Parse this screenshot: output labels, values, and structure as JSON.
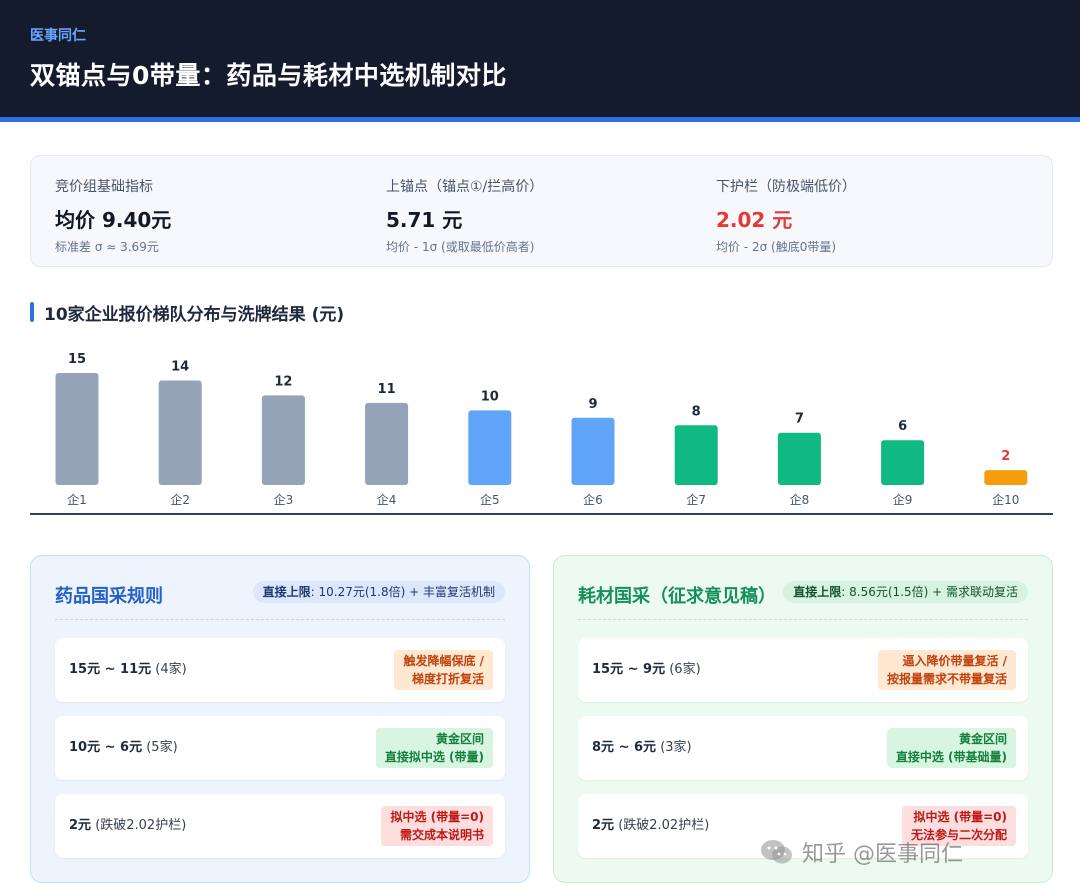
{
  "header": {
    "brand": "医事同仁",
    "title": "双锚点与0带量：药品与耗材中选机制对比"
  },
  "metrics": [
    {
      "label": "竞价组基础指标",
      "value": "均价 9.40元",
      "note": "标准差 σ ≈ 3.69元",
      "color": "#111827"
    },
    {
      "label": "上锚点（锚点①/拦高价）",
      "value": "5.71 元",
      "note": "均价 - 1σ (或取最低价高者)",
      "color": "#111827"
    },
    {
      "label": "下护栏（防极端低价）",
      "value": "2.02 元",
      "note": "均价 - 2σ (触底0带量)",
      "color": "#e53935"
    }
  ],
  "chart_title": "10家企业报价梯队分布与洗牌结果 (元)",
  "chart_data": {
    "type": "bar",
    "title": "10家企业报价梯队分布与洗牌结果 (元)",
    "categories": [
      "企1",
      "企2",
      "企3",
      "企4",
      "企5",
      "企6",
      "企7",
      "企8",
      "企9",
      "企10"
    ],
    "values": [
      15,
      14,
      12,
      11,
      10,
      9,
      8,
      7,
      6,
      2
    ],
    "bar_colors": [
      "#94a3b8",
      "#94a3b8",
      "#94a3b8",
      "#94a3b8",
      "#60a5fa",
      "#60a5fa",
      "#10b981",
      "#10b981",
      "#10b981",
      "#f59e0b"
    ],
    "label_colors": [
      "#1e293b",
      "#1e293b",
      "#1e293b",
      "#1e293b",
      "#1e293b",
      "#1e293b",
      "#1e293b",
      "#1e293b",
      "#1e293b",
      "#e53935"
    ],
    "xlabel": "",
    "ylabel": "",
    "ylim": [
      0,
      15
    ],
    "grid": false,
    "legend": "none"
  },
  "panels": {
    "drug": {
      "title": "药品国采规则",
      "pill_key": "直接上限",
      "pill_rest": ": 10.27元(1.8倍) + 丰富复活机制",
      "rows": [
        {
          "range": "15元 ~ 11元",
          "count": "(4家)",
          "tag_line1": "触发降幅保底 /",
          "tag_line2": "梯度打折复活",
          "tag_style": "orange"
        },
        {
          "range": "10元 ~ 6元",
          "count": "(5家)",
          "tag_line1": "黄金区间",
          "tag_line2": "直接拟中选 (带量)",
          "tag_style": "green"
        },
        {
          "range": "2元",
          "count": "(跌破2.02护栏)",
          "tag_line1": "拟中选 (带量=0)",
          "tag_line2": "需交成本说明书",
          "tag_style": "red"
        }
      ]
    },
    "consumable": {
      "title": "耗材国采（征求意见稿）",
      "pill_key": "直接上限",
      "pill_rest": ": 8.56元(1.5倍) + 需求联动复活",
      "rows": [
        {
          "range": "15元 ~ 9元",
          "count": "(6家)",
          "tag_line1": "逼入降价带量复活 /",
          "tag_line2": "按报量需求不带量复活",
          "tag_style": "orange"
        },
        {
          "range": "8元 ~ 6元",
          "count": "(3家)",
          "tag_line1": "黄金区间",
          "tag_line2": "直接中选 (带基础量)",
          "tag_style": "green"
        },
        {
          "range": "2元",
          "count": "(跌破2.02护栏)",
          "tag_line1": "拟中选 (带量=0)",
          "tag_line2": "无法参与二次分配",
          "tag_style": "red"
        }
      ]
    }
  },
  "watermark": {
    "text": "知乎 @医事同仁",
    "icon": "wechat-icon"
  }
}
